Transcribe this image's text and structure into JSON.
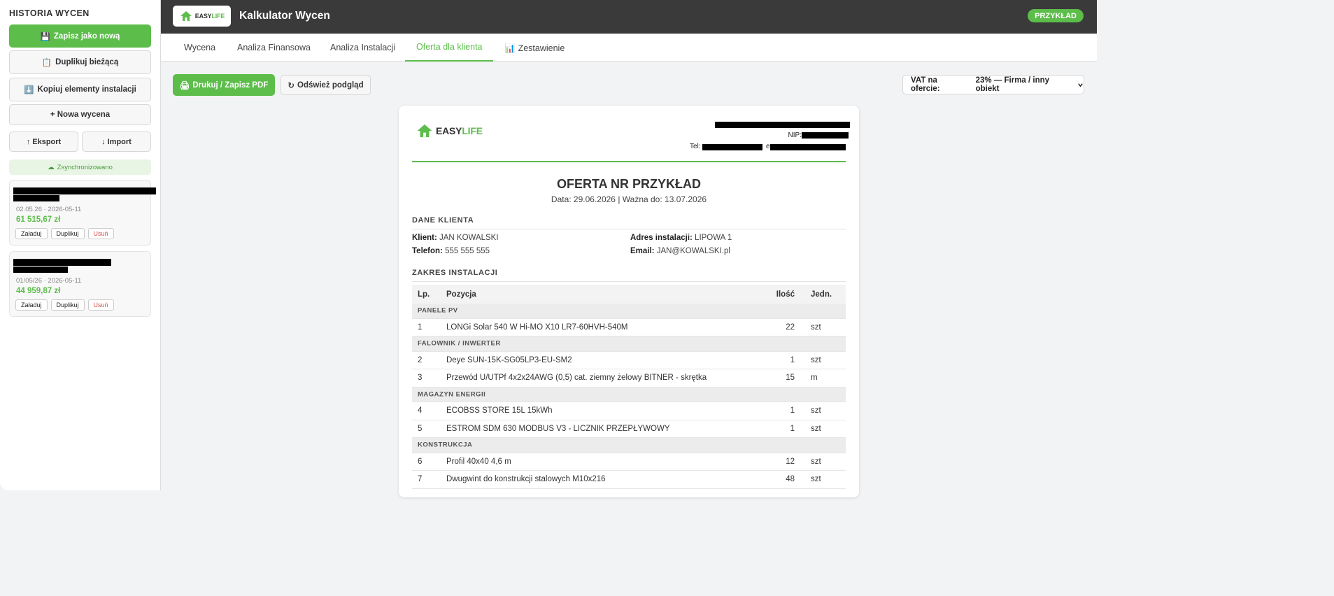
{
  "sidebar": {
    "title": "HISTORIA WYCEN",
    "save_new": "Zapisz jako nową",
    "duplicate_current": "Duplikuj bieżącą",
    "copy_elements": "Kopiuj elementy instalacji",
    "new_quote": "+ Nowa wycena",
    "export": "Eksport",
    "import": "Import",
    "sync_status": "Zsynchronizowano",
    "cards": [
      {
        "meta": "02.05.26 · 2026-05-11",
        "amount": "61 515,67 zł",
        "load": "Załaduj",
        "duplicate": "Duplikuj",
        "delete": "Usuń"
      },
      {
        "meta": "01/05/26 · 2026-05-11",
        "amount": "44 959,87 zł",
        "load": "Załaduj",
        "duplicate": "Duplikuj",
        "delete": "Usuń"
      }
    ]
  },
  "header": {
    "logo_text_a": "EASY",
    "logo_text_b": "LIFE",
    "title": "Kalkulator Wycen",
    "badge": "PRZYKŁAD"
  },
  "tabs": [
    "Wycena",
    "Analiza Finansowa",
    "Analiza Instalacji",
    "Oferta dla klienta",
    "Zestawienie"
  ],
  "toolbar": {
    "print": "Drukuj / Zapisz PDF",
    "refresh": "Odśwież podgląd",
    "vat_label": "VAT na ofercie:",
    "vat_value": "23% — Firma / inny obiekt"
  },
  "offer": {
    "logo_text_a": "EASY",
    "logo_text_b": "LIFE",
    "nip_label": "NIP:",
    "tel_label": "Tel:",
    "email_prefix": "e",
    "heading": "OFERTA NR PRZYKŁAD",
    "subline": "Data: 29.06.2026  |  Ważna do: 13.07.2026",
    "client_section": "DANE KLIENTA",
    "client_label": "Klient:",
    "client_value": "JAN KOWALSKI",
    "address_label": "Adres instalacji:",
    "address_value": "LIPOWA 1",
    "phone_label": "Telefon:",
    "phone_value": "555 555 555",
    "email_label": "Email:",
    "email_value": "JAN@KOWALSKI.pl",
    "scope_section": "ZAKRES INSTALACJI",
    "table_headers": {
      "lp": "Lp.",
      "position": "Pozycja",
      "qty": "Ilość",
      "unit": "Jedn."
    },
    "groups": [
      {
        "name": "PANELE PV",
        "items": [
          {
            "lp": "1",
            "name": "LONGi Solar 540 W Hi-MO X10 LR7-60HVH-540M",
            "qty": "22",
            "unit": "szt"
          }
        ]
      },
      {
        "name": "FALOWNIK / INWERTER",
        "items": [
          {
            "lp": "2",
            "name": "Deye SUN-15K-SG05LP3-EU-SM2",
            "qty": "1",
            "unit": "szt"
          },
          {
            "lp": "3",
            "name": "Przewód U/UTPf 4x2x24AWG (0,5) cat. ziemny żelowy BITNER - skrętka",
            "qty": "15",
            "unit": "m"
          }
        ]
      },
      {
        "name": "MAGAZYN ENERGII",
        "items": [
          {
            "lp": "4",
            "name": "ECOBSS STORE 15L 15kWh",
            "qty": "1",
            "unit": "szt"
          },
          {
            "lp": "5",
            "name": "ESTROM SDM 630 MODBUS V3 - LICZNIK PRZEPŁYWOWY",
            "qty": "1",
            "unit": "szt"
          }
        ]
      },
      {
        "name": "KONSTRUKCJA",
        "items": [
          {
            "lp": "6",
            "name": "Profil 40x40 4,6 m",
            "qty": "12",
            "unit": "szt"
          },
          {
            "lp": "7",
            "name": "Dwugwint do konstrukcji stalowych M10x216",
            "qty": "48",
            "unit": "szt"
          }
        ]
      }
    ]
  },
  "colors": {
    "accent": "#5cbd4a",
    "header_bg": "#3a3a3a",
    "delete": "#d9534f"
  },
  "icons": [
    "floppy-disk-icon",
    "clipboard-icon",
    "download-arrow-icon",
    "arrow-up-icon",
    "arrow-down-icon",
    "cloud-icon",
    "house-logo-icon",
    "bar-chart-icon",
    "printer-icon",
    "refresh-icon",
    "chevron-down-icon"
  ]
}
